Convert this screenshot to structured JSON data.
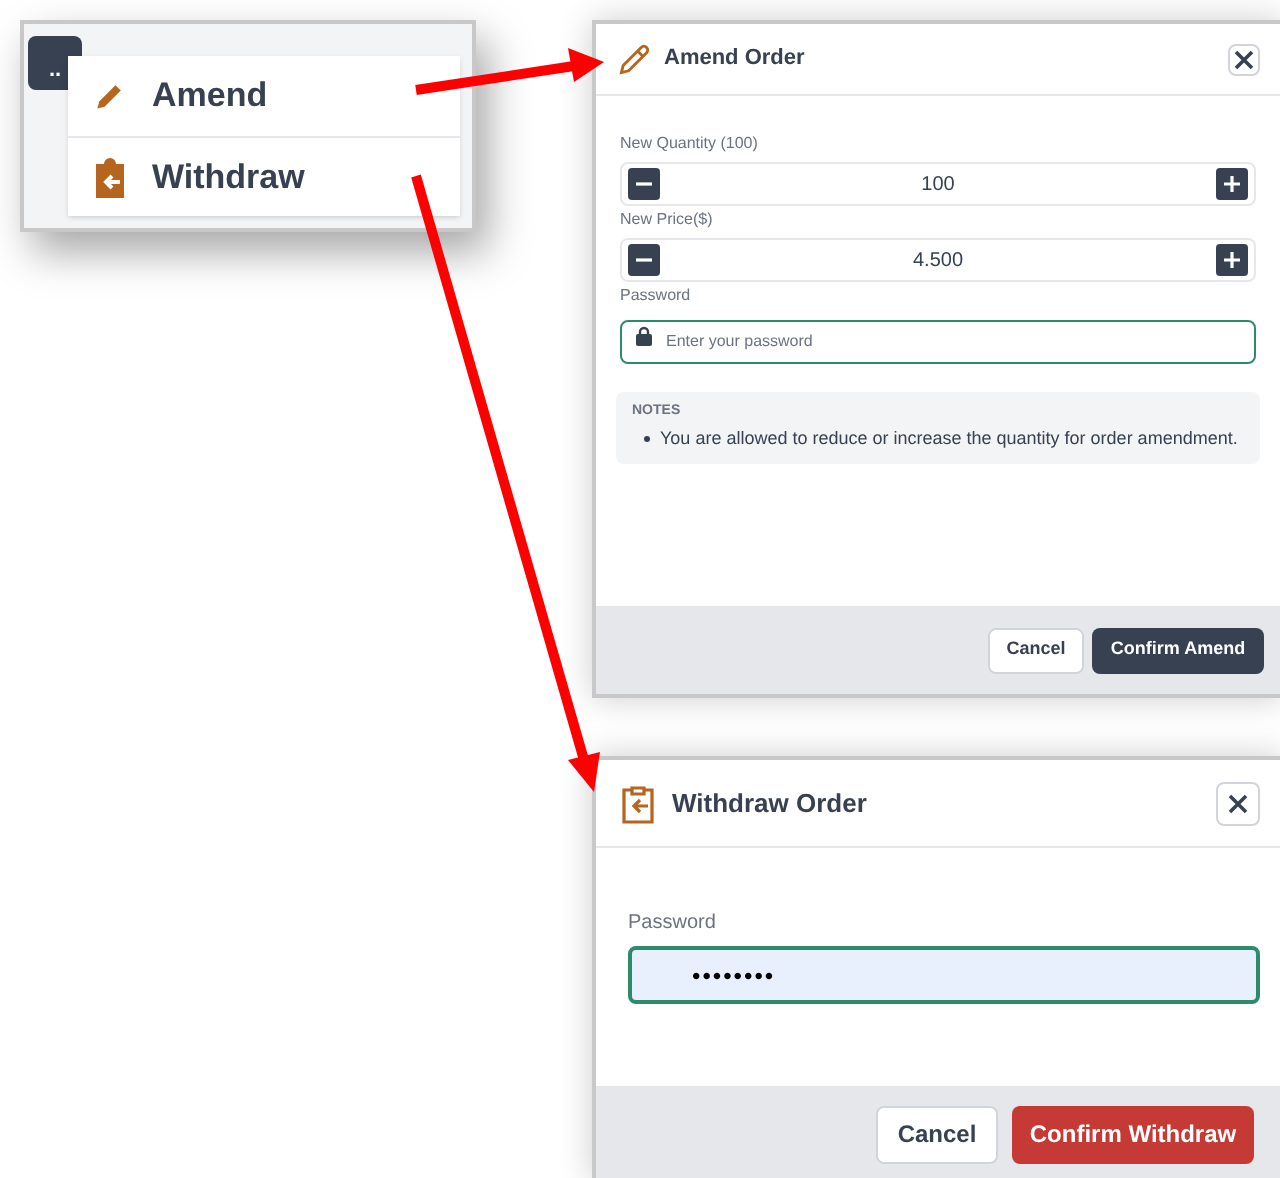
{
  "menu": {
    "trigger": "..",
    "items": [
      {
        "label": "Amend"
      },
      {
        "label": "Withdraw"
      }
    ]
  },
  "amend_dialog": {
    "title": "Amend Order",
    "fields": [
      {
        "kind": "stepper",
        "label": "New Quantity (100)",
        "value": "100"
      },
      {
        "kind": "stepper",
        "label": "New Price($)",
        "value": "4.500"
      },
      {
        "kind": "password",
        "label": "Password",
        "placeholder": "Enter your password"
      }
    ],
    "notes": {
      "heading": "NOTES",
      "items": [
        "You are allowed to reduce or increase the quantity for order amendment."
      ]
    },
    "buttons": [
      {
        "label": "Cancel",
        "kind": "secondary"
      },
      {
        "label": "Confirm Amend",
        "kind": "dark"
      }
    ]
  },
  "withdraw_dialog": {
    "title": "Withdraw Order",
    "fields": [
      {
        "kind": "password",
        "label": "Password",
        "value": "••••••••"
      }
    ],
    "buttons": [
      {
        "label": "Cancel",
        "kind": "secondary"
      },
      {
        "label": "Confirm Withdraw",
        "kind": "danger"
      }
    ]
  }
}
